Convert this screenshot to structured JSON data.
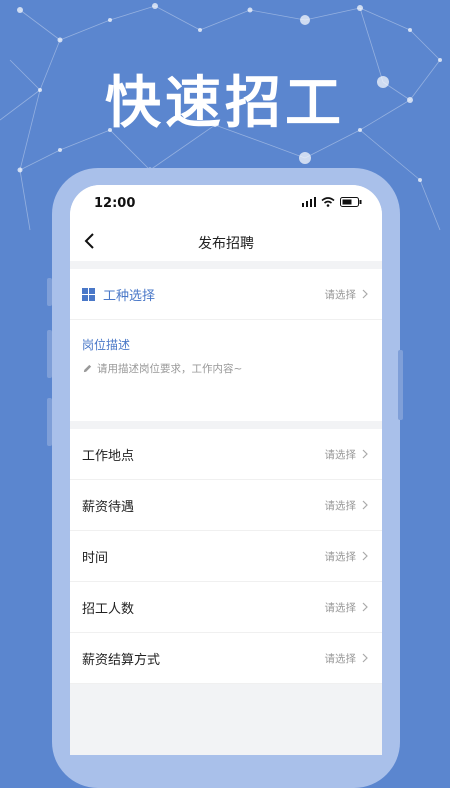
{
  "banner": {
    "title": "快速招工"
  },
  "status": {
    "time": "12:00"
  },
  "nav": {
    "title": "发布招聘"
  },
  "job_type": {
    "label": "工种选择",
    "value": "请选择"
  },
  "description": {
    "title": "岗位描述",
    "placeholder": "请用描述岗位要求，工作内容~"
  },
  "fields": [
    {
      "label": "工作地点",
      "value": "请选择"
    },
    {
      "label": "薪资待遇",
      "value": "请选择"
    },
    {
      "label": "时间",
      "value": "请选择"
    },
    {
      "label": "招工人数",
      "value": "请选择"
    },
    {
      "label": "薪资结算方式",
      "value": "请选择"
    }
  ],
  "colors": {
    "background": "#5b86cf",
    "accent": "#4a78c8",
    "frame": "#a9c0ea"
  }
}
